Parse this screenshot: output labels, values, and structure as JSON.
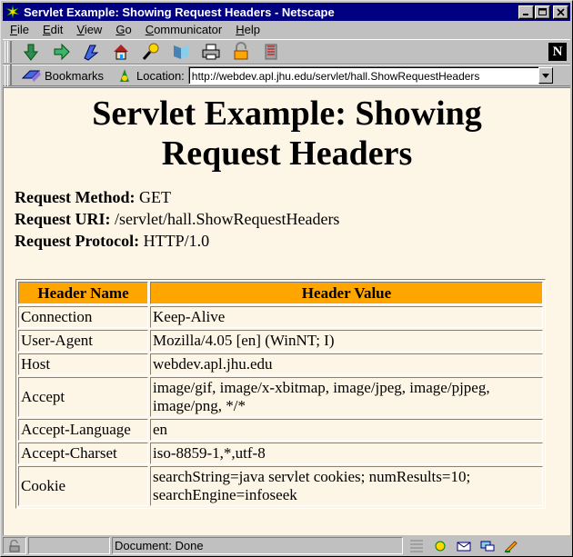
{
  "window": {
    "title": "Servlet Example: Showing Request Headers - Netscape",
    "minimize_glyph": "_",
    "maximize_glyph": "□",
    "close_glyph": "×"
  },
  "menu": [
    "File",
    "Edit",
    "View",
    "Go",
    "Communicator",
    "Help"
  ],
  "menu_mnemonics": [
    "F",
    "E",
    "V",
    "G",
    "C",
    "H"
  ],
  "toolbar": {
    "icons": [
      "back-icon",
      "forward-icon",
      "reload-icon",
      "home-icon",
      "search-icon",
      "guide-icon",
      "print-icon",
      "security-icon",
      "stop-icon"
    ],
    "logo_text": "N"
  },
  "location_bar": {
    "bookmarks_label": "Bookmarks",
    "location_label": "Location:",
    "url": "http://webdev.apl.jhu.edu/servlet/hall.ShowRequestHeaders"
  },
  "page": {
    "heading_line1": "Servlet Example: Showing",
    "heading_line2": "Request Headers",
    "request": [
      {
        "label": "Request Method:",
        "value": "GET"
      },
      {
        "label": "Request URI:",
        "value": "/servlet/hall.ShowRequestHeaders"
      },
      {
        "label": "Request Protocol:",
        "value": "HTTP/1.0"
      }
    ],
    "table": {
      "columns": [
        "Header Name",
        "Header Value"
      ],
      "rows": [
        {
          "name": "Connection",
          "value": "Keep-Alive"
        },
        {
          "name": "User-Agent",
          "value": "Mozilla/4.05 [en] (WinNT; I)"
        },
        {
          "name": "Host",
          "value": "webdev.apl.jhu.edu"
        },
        {
          "name": "Accept",
          "value": "image/gif, image/x-xbitmap, image/jpeg, image/pjpeg, image/png, */*"
        },
        {
          "name": "Accept-Language",
          "value": "en"
        },
        {
          "name": "Accept-Charset",
          "value": "iso-8859-1,*,utf-8"
        },
        {
          "name": "Cookie",
          "value": "searchString=java servlet cookies; numResults=10; searchEngine=infoseek"
        }
      ]
    }
  },
  "status_bar": {
    "text": "Document: Done"
  },
  "colors": {
    "titlebar": "#000080",
    "page_background": "#fdf5e6",
    "table_header": "#ffa500",
    "chrome": "#c0c0c0"
  }
}
